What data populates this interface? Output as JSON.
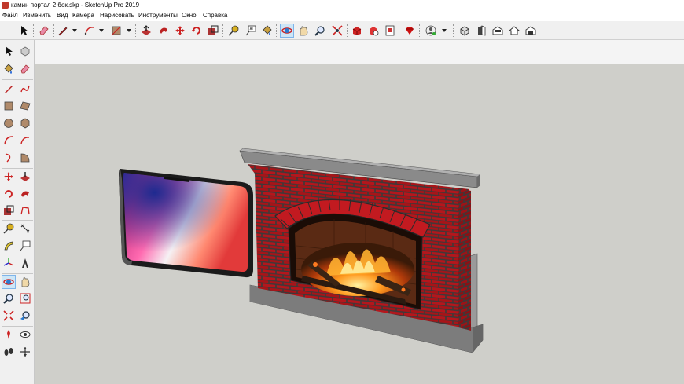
{
  "window": {
    "title": "камин портал 2 бок.skp - SketchUp Pro 2019",
    "accent": "#c0392b"
  },
  "menu": {
    "items": [
      "Файл",
      "Изменить",
      "Вид",
      "Камера",
      "Нарисовать",
      "Инструменты",
      "Окно",
      "Справка"
    ]
  },
  "toolbar": {
    "buttons": [
      {
        "icon": "select-arrow-icon"
      },
      {
        "icon": "eraser-icon"
      },
      {
        "icon": "pencil-line-icon"
      },
      {
        "icon": "arc-icon"
      },
      {
        "icon": "rectangle-icon"
      },
      {
        "icon": "push-pull-icon"
      },
      {
        "icon": "follow-me-icon"
      },
      {
        "icon": "move-icon"
      },
      {
        "icon": "rotate-icon"
      },
      {
        "icon": "scale-icon"
      },
      {
        "icon": "tape-measure-icon"
      },
      {
        "icon": "text-icon"
      },
      {
        "icon": "paint-bucket-icon"
      },
      {
        "icon": "orbit-icon"
      },
      {
        "icon": "pan-icon"
      },
      {
        "icon": "zoom-icon"
      },
      {
        "icon": "zoom-extents-icon"
      },
      {
        "icon": "warehouse-icon"
      },
      {
        "icon": "extension-warehouse-icon"
      },
      {
        "icon": "layout-icon"
      },
      {
        "icon": "ruby-console-icon"
      },
      {
        "icon": "user-account-icon"
      },
      {
        "icon": "iso-view-icon"
      },
      {
        "icon": "front-view-icon"
      },
      {
        "icon": "top-view-icon"
      },
      {
        "icon": "home-view-icon"
      },
      {
        "icon": "back-view-icon"
      }
    ]
  },
  "sidebar": {
    "buttons": [
      "select-arrow-icon",
      "make-component-icon",
      "paint-bucket-icon",
      "eraser-icon",
      "pencil-line-icon",
      "freehand-icon",
      "rectangle-icon",
      "rotated-rectangle-icon",
      "circle-icon",
      "polygon-icon",
      "arc-icon",
      "two-point-arc-icon",
      "three-point-arc-icon",
      "pie-icon",
      "move-icon",
      "push-pull-icon",
      "rotate-icon",
      "follow-me-icon",
      "scale-icon",
      "offset-icon",
      "tape-measure-icon",
      "dimension-icon",
      "protractor-icon",
      "text-icon",
      "axes-icon",
      "3d-text-icon",
      "orbit-icon",
      "pan-icon",
      "zoom-icon",
      "zoom-window-icon",
      "zoom-extents-icon",
      "previous-view-icon",
      "position-camera-icon",
      "look-around-icon",
      "walk-icon",
      "section-plane-icon"
    ]
  },
  "model": {
    "objects": [
      "phone-image-panel",
      "brick-fireplace"
    ],
    "colors": {
      "brick": "#b5161c",
      "mortar": "#3a3a3a",
      "stone": "#8a8a8a",
      "fire": "#ff8a1c"
    }
  }
}
